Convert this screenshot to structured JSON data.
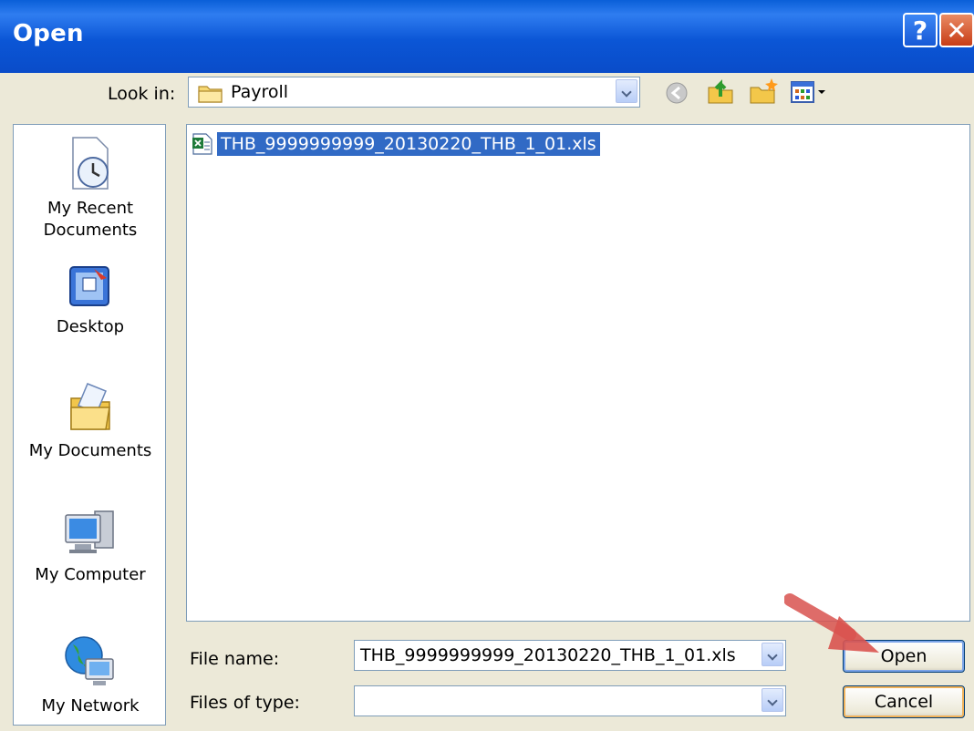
{
  "window": {
    "title": "Open",
    "help_glyph": "?",
    "close_glyph": "✕"
  },
  "look_in": {
    "label": "Look in:",
    "value": "Payroll"
  },
  "toolbar": {
    "icons": [
      "back-icon",
      "up-folder-icon",
      "new-folder-icon",
      "views-menu-icon"
    ]
  },
  "places": [
    {
      "label": "My Recent\nDocuments",
      "icon": "recent-documents-icon"
    },
    {
      "label": "Desktop",
      "icon": "desktop-icon"
    },
    {
      "label": "My Documents",
      "icon": "my-documents-icon"
    },
    {
      "label": "My Computer",
      "icon": "my-computer-icon"
    },
    {
      "label": "My Network",
      "icon": "my-network-icon"
    }
  ],
  "files": [
    {
      "name": "THB_9999999999_20130220_THB_1_01.xls",
      "icon": "excel-file-icon",
      "selected": true
    }
  ],
  "filename": {
    "label": "File name:",
    "value": "THB_9999999999_20130220_THB_1_01.xls"
  },
  "filetype": {
    "label": "Files of type:",
    "value": ""
  },
  "buttons": {
    "open": "Open",
    "cancel": "Cancel"
  },
  "colors": {
    "title_bar": "#0a54d6",
    "selection": "#316ac5",
    "dialog_bg": "#ece9d8",
    "annotation_arrow": "#d9534f"
  }
}
